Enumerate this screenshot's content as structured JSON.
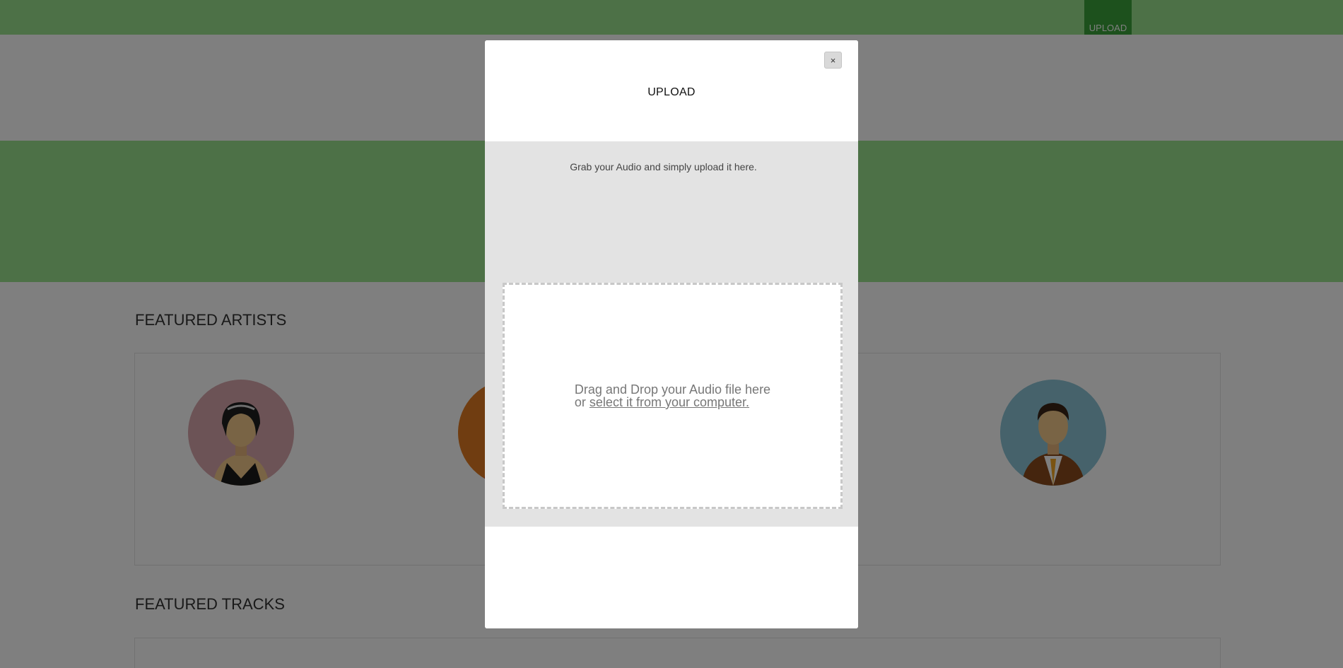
{
  "nav": {
    "upload_label": "UPLOAD"
  },
  "sections": {
    "artists_title": "FEATURED ARTISTS",
    "tracks_title": "FEATURED TRACKS"
  },
  "colors": {
    "nav_green": "#9be38f",
    "nav_active": "#3aa33a",
    "overlay": "rgba(0,0,0,0.5)",
    "modal_body_gray": "#e3e3e3"
  },
  "modal": {
    "close_label": "×",
    "title": "UPLOAD",
    "instructions": "Grab your Audio and simply upload it here.",
    "dropzone": {
      "line1": "Drag and Drop your Audio file here",
      "line2_prefix": "or ",
      "line2_link": "select it from your computer."
    }
  },
  "icons": [
    "close-icon",
    "artist-avatar-female",
    "artist-avatar-male"
  ]
}
